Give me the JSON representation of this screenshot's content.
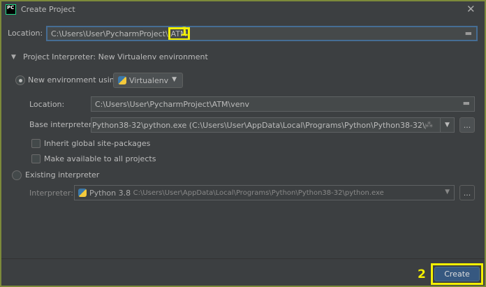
{
  "window": {
    "title": "Create Project",
    "logo": "PC"
  },
  "location": {
    "label": "Location:",
    "value_prefix": "C:\\Users\\User\\PycharmProject\\",
    "value_highlight": "ATM"
  },
  "annotations": {
    "one": "1",
    "two": "2"
  },
  "interpreter_section": {
    "title": "Project Interpreter: New Virtualenv environment",
    "new_env": {
      "label": "New environment using",
      "tool": "Virtualenv",
      "selected": true
    },
    "venv_location": {
      "label": "Location:",
      "value": "C:\\Users\\User\\PycharmProject\\ATM\\venv"
    },
    "base": {
      "label": "Base interpreter:",
      "value": "Python38-32\\python.exe (C:\\Users\\User\\AppData\\Local\\Programs\\Python\\Python38-32\\python.exe)",
      "more": "..."
    },
    "inherit": {
      "label": "Inherit global site-packages",
      "checked": false
    },
    "available": {
      "label": "Make available to all projects",
      "checked": false
    },
    "existing": {
      "label": "Existing interpreter",
      "selected": false
    },
    "interpreter": {
      "label": "Interpreter:",
      "name": "Python 3.8",
      "path": "C:\\Users\\User\\AppData\\Local\\Programs\\Python\\Python38-32\\python.exe",
      "more": "..."
    }
  },
  "footer": {
    "create": "Create"
  }
}
